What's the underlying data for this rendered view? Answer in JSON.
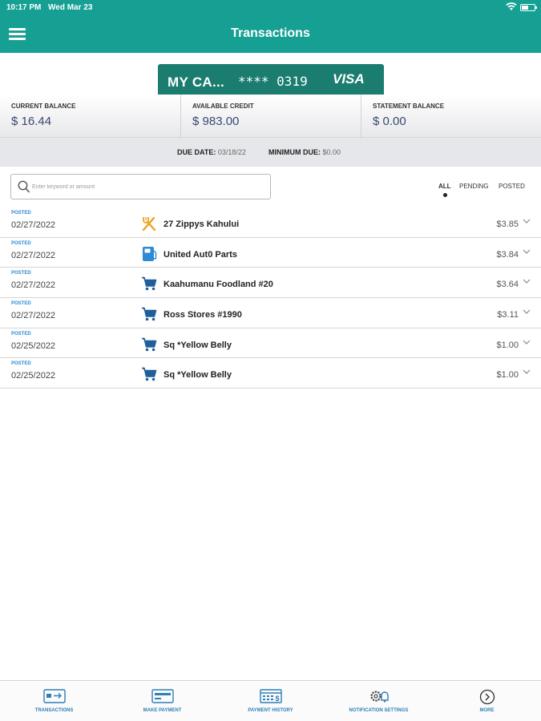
{
  "status_bar": {
    "time": "10:17 PM",
    "date": "Wed Mar 23"
  },
  "header": {
    "title": "Transactions"
  },
  "card": {
    "name": "MY CA...",
    "masked_number": "**** 0319",
    "brand": "VISA"
  },
  "balances": [
    {
      "label": "CURRENT BALANCE",
      "value": "$ 16.44"
    },
    {
      "label": "AVAILABLE CREDIT",
      "value": "$ 983.00"
    },
    {
      "label": "STATEMENT BALANCE",
      "value": "$ 0.00"
    }
  ],
  "due": {
    "due_label": "DUE DATE:",
    "due_value": "03/18/22",
    "minimum_label": "MINIMUM DUE:",
    "minimum_value": "$0.00"
  },
  "search": {
    "placeholder": "Enter keyword or amount"
  },
  "filters": {
    "all": "ALL",
    "pending": "PENDING",
    "posted": "POSTED",
    "selected": "ALL"
  },
  "transactions": [
    {
      "status": "POSTED",
      "date": "02/27/2022",
      "icon": "restaurant-icon",
      "merchant": "27 Zippys Kahului",
      "amount": "$3.85"
    },
    {
      "status": "POSTED",
      "date": "02/27/2022",
      "icon": "fuel-pump-icon",
      "merchant": "United Aut0 Parts",
      "amount": "$3.84"
    },
    {
      "status": "POSTED",
      "date": "02/27/2022",
      "icon": "shopping-cart-icon",
      "merchant": "Kaahumanu Foodland #20",
      "amount": "$3.64"
    },
    {
      "status": "POSTED",
      "date": "02/27/2022",
      "icon": "shopping-cart-icon",
      "merchant": "Ross Stores #1990",
      "amount": "$3.11"
    },
    {
      "status": "POSTED",
      "date": "02/25/2022",
      "icon": "shopping-cart-icon",
      "merchant": "Sq *Yellow Belly",
      "amount": "$1.00"
    },
    {
      "status": "POSTED",
      "date": "02/25/2022",
      "icon": "shopping-cart-icon",
      "merchant": "Sq *Yellow Belly",
      "amount": "$1.00"
    }
  ],
  "bottom_nav": [
    {
      "label": "TRANSACTIONS",
      "icon": "transactions-icon"
    },
    {
      "label": "MAKE PAYMENT",
      "icon": "make-payment-icon"
    },
    {
      "label": "PAYMENT HISTORY",
      "icon": "payment-history-icon"
    },
    {
      "label": "NOTIFICATION SETTINGS",
      "icon": "notification-settings-icon"
    },
    {
      "label": "MORE",
      "icon": "more-chevron-icon"
    }
  ],
  "colors": {
    "primary": "#16a094",
    "card": "#1a7d70",
    "icon_blue": "#2d7fb8",
    "status_blue": "#2d8ad6",
    "food_orange": "#f0a020"
  }
}
